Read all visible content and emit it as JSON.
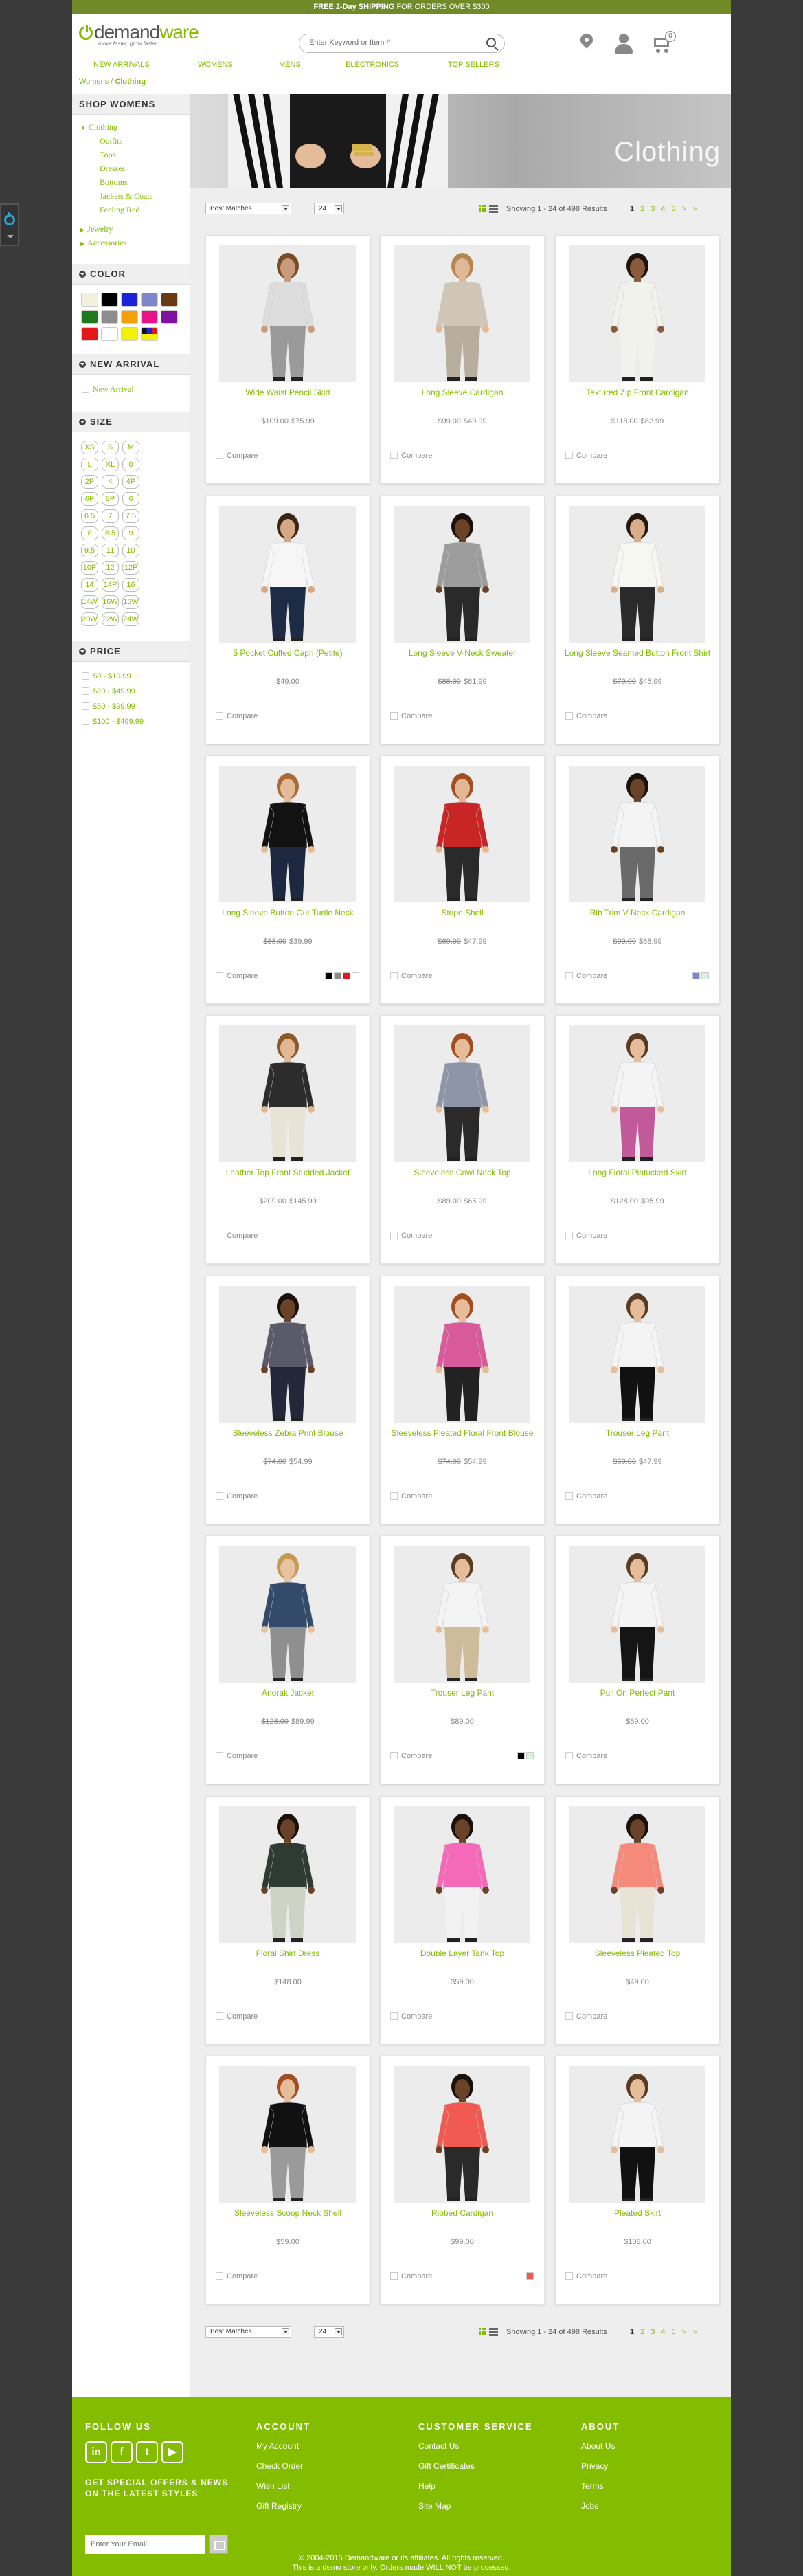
{
  "banner": {
    "bold": "FREE 2-Day SHIPPING",
    "rest": " FOR ORDERS OVER $300"
  },
  "header": {
    "logo_prefix": "demand",
    "logo_suffix": "ware",
    "tagline": "move faster. grow faster.",
    "search_placeholder": "Enter Keyword or Item #",
    "cart_count": "0"
  },
  "nav": [
    "NEW ARRIVALS",
    "WOMENS",
    "MENS",
    "ELECTRONICS",
    "TOP SELLERS"
  ],
  "breadcrumb": {
    "parent": "Womens",
    "current": "Clothing"
  },
  "sidebar": {
    "shop_title": "SHOP WOMENS",
    "categories": {
      "main": "Clothing",
      "subs": [
        "Outfits",
        "Tops",
        "Dresses",
        "Bottoms",
        "Jackets & Coats",
        "Feeling Red"
      ],
      "others": [
        "Jewelry",
        "Accessories"
      ]
    },
    "color_title": "COLOR",
    "colors": [
      "#f3f0dc",
      "#000000",
      "#1a23d9",
      "#7f86c9",
      "#6b3a12",
      "#1d7a1d",
      "#8d8d8d",
      "#f5a00a",
      "#e8138a",
      "#8011a0",
      "#e31818",
      "#ffffff",
      "#f1f10a",
      "multi"
    ],
    "new_arrival_title": "NEW ARRIVAL",
    "new_arrival_option": "New Arrival",
    "size_title": "SIZE",
    "sizes": [
      "XS",
      "S",
      "M",
      "L",
      "XL",
      "0",
      "2P",
      "4",
      "4P",
      "6P",
      "8P",
      "6",
      "6.5",
      "7",
      "7.5",
      "8",
      "8.5",
      "9",
      "9.5",
      "11",
      "10",
      "10P",
      "12",
      "12P",
      "14",
      "14P",
      "16",
      "14W",
      "16W",
      "18W",
      "20W",
      "22W",
      "24W"
    ],
    "price_title": "PRICE",
    "prices": [
      "$0 - $19.99",
      "$20 - $49.99",
      "$50 - $99.99",
      "$100 - $499.99"
    ]
  },
  "hero": {
    "title": "Clothing"
  },
  "toolbar": {
    "sort": "Best Matches",
    "per_page": "24",
    "showing": "Showing 1 - 24 of 498 Results",
    "pages": [
      "1",
      "2",
      "3",
      "4",
      "5"
    ],
    "next": ">",
    "last": "»"
  },
  "compare_label": "Compare",
  "products": [
    {
      "name": "Wide Waist Pencil Skirt",
      "was": "$109.00",
      "now": "$75.99",
      "top": "#ddd",
      "bottom": "#9a9a9a",
      "skin": "#c99b7e",
      "hair": "#7a4b25",
      "swatches": []
    },
    {
      "name": "Long Sleeve Cardigan",
      "was": "$99.00",
      "now": "$49.99",
      "top": "#cfc6b8",
      "bottom": "#b8ae9e",
      "skin": "#e0b896",
      "hair": "#b58650",
      "swatches": []
    },
    {
      "name": "Textured Zip Front Cardigan",
      "was": "$118.00",
      "now": "$82.99",
      "top": "#f2f2ec",
      "bottom": "#f2f2ec",
      "skin": "#8a5a3c",
      "hair": "#1f140d",
      "swatches": []
    },
    {
      "name": "5 Pocket Cuffed Capri (Petite)",
      "was": "",
      "now": "$49.00",
      "top": "#f6f6f6",
      "bottom": "#1d2b44",
      "skin": "#d6a784",
      "hair": "#3a2516",
      "swatches": []
    },
    {
      "name": "Long Sleeve V-Neck Sweater",
      "was": "$88.00",
      "now": "$61.99",
      "top": "#9c9c9c",
      "bottom": "#2a2a2a",
      "skin": "#6a4228",
      "hair": "#1a110a",
      "swatches": []
    },
    {
      "name": "Long Sleeve Seamed Button Front Shirt",
      "was": "$79.00",
      "now": "$45.99",
      "top": "#f7f7f2",
      "bottom": "#2a2a2a",
      "skin": "#d9ad8a",
      "hair": "#24170e",
      "swatches": []
    },
    {
      "name": "Long Sleeve Button Out Turtle Neck",
      "was": "$88.00",
      "now": "$39.99",
      "top": "#121212",
      "bottom": "#1c2740",
      "skin": "#e4bb98",
      "hair": "#a86a36",
      "swatches": [
        "#000000",
        "#8d8d8d",
        "#e31818",
        "#ffffff"
      ]
    },
    {
      "name": "Stripe Shell",
      "was": "$69.00",
      "now": "$47.99",
      "top": "#c92525",
      "bottom": "#2a2a2a",
      "skin": "#e2b794",
      "hair": "#a34d22",
      "swatches": []
    },
    {
      "name": "Rib Trim V-Neck Cardigan",
      "was": "$99.00",
      "now": "$68.99",
      "top": "#f4f4f4",
      "bottom": "#6a6a6a",
      "skin": "#6a4228",
      "hair": "#1a110a",
      "swatches": [
        "#7f86c9",
        "#d9f1e0"
      ]
    },
    {
      "name": "Leather Top Front Studded Jacket",
      "was": "$209.00",
      "now": "$145.99",
      "top": "#2c2c2c",
      "bottom": "#e9e3d6",
      "skin": "#e2b794",
      "hair": "#8a5a2a",
      "swatches": []
    },
    {
      "name": "Sleeveless Cowl Neck Top",
      "was": "$89.00",
      "now": "$65.99",
      "top": "#8e95a8",
      "bottom": "#2a2a2a",
      "skin": "#e5bd9a",
      "hair": "#a34d22",
      "swatches": []
    },
    {
      "name": "Long Floral Pintucked Skirt",
      "was": "$128.00",
      "now": "$95.99",
      "top": "#f4f4f4",
      "bottom": "#c25a9a",
      "skin": "#e5bd9a",
      "hair": "#5a3a20",
      "swatches": []
    },
    {
      "name": "Sleeveless Zebra Print Blouse",
      "was": "$74.00",
      "now": "$54.99",
      "top": "#5a5a6a",
      "bottom": "#22283a",
      "skin": "#6a4228",
      "hair": "#1a110a",
      "swatches": []
    },
    {
      "name": "Sleeveless Pleated Floral Front Blouse",
      "was": "$74.00",
      "now": "$54.99",
      "top": "#d85a9a",
      "bottom": "#222222",
      "skin": "#e5bd9a",
      "hair": "#a34d22",
      "swatches": []
    },
    {
      "name": "Trouser Leg Pant",
      "was": "$69.00",
      "now": "$47.99",
      "top": "#f4f4f4",
      "bottom": "#111111",
      "skin": "#e5bd9a",
      "hair": "#5a3a20",
      "swatches": []
    },
    {
      "name": "Anorak Jacket",
      "was": "$128.00",
      "now": "$89.99",
      "top": "#334a6a",
      "bottom": "#8f8f8f",
      "skin": "#e7c39f",
      "hair": "#c49a50",
      "swatches": []
    },
    {
      "name": "Trouser Leg Pant",
      "was": "",
      "now": "$89.00",
      "top": "#f4f4f4",
      "bottom": "#cdbb9a",
      "skin": "#e5bd9a",
      "hair": "#5a3a20",
      "swatches": [
        "#000000",
        "#d9f1e0"
      ]
    },
    {
      "name": "Pull On Perfect Pant",
      "was": "",
      "now": "$69.00",
      "top": "#f4f4f4",
      "bottom": "#151515",
      "skin": "#e5bd9a",
      "hair": "#5a3a20",
      "swatches": []
    },
    {
      "name": "Floral Shirt Dress",
      "was": "",
      "now": "$148.00",
      "top": "#2d3b33",
      "bottom": "#cfd3c6",
      "skin": "#6a4228",
      "hair": "#1a110a",
      "swatches": []
    },
    {
      "name": "Double Layer Tank Top",
      "was": "",
      "now": "$59.00",
      "top": "#f56ab8",
      "bottom": "#f2f2f2",
      "skin": "#6a4228",
      "hair": "#1a110a",
      "swatches": []
    },
    {
      "name": "Sleeveless Pleated Top",
      "was": "",
      "now": "$49.00",
      "top": "#f58a7a",
      "bottom": "#e9e3d6",
      "skin": "#6a4228",
      "hair": "#1a110a",
      "swatches": []
    },
    {
      "name": "Sleeveless Scoop Neck Shell",
      "was": "",
      "now": "$59.00",
      "top": "#111111",
      "bottom": "#9a9a9a",
      "skin": "#e5bd9a",
      "hair": "#a34d22",
      "swatches": []
    },
    {
      "name": "Ribbed Cardigan",
      "was": "",
      "now": "$99.00",
      "top": "#f05a50",
      "bottom": "#2a2a2a",
      "skin": "#6a4228",
      "hair": "#1a110a",
      "swatches": [
        "#f05a50"
      ]
    },
    {
      "name": "Pleated Skirt",
      "was": "",
      "now": "$108.00",
      "top": "#f4f4f4",
      "bottom": "#111111",
      "skin": "#e5bd9a",
      "hair": "#5a3a20",
      "swatches": []
    }
  ],
  "footer": {
    "follow_title": "FOLLOW US",
    "social": [
      "in",
      "f",
      "t",
      "▶"
    ],
    "signup": "GET SPECIAL OFFERS & NEWS ON THE LATEST STYLES",
    "email_placeholder": "Enter Your Email",
    "account_title": "ACCOUNT",
    "account_links": [
      "My Account",
      "Check Order",
      "Wish List",
      "Gift Registry"
    ],
    "service_title": "CUSTOMER SERVICE",
    "service_links": [
      "Contact Us",
      "Gift Certificates",
      "Help",
      "Site Map"
    ],
    "about_title": "ABOUT",
    "about_links": [
      "About Us",
      "Privacy",
      "Terms",
      "Jobs"
    ],
    "copyright": "© 2004-2015 Demandware or its affiliates. All rights reserved.",
    "demo": "This is a demo store only. Orders made WILL NOT be processed."
  }
}
